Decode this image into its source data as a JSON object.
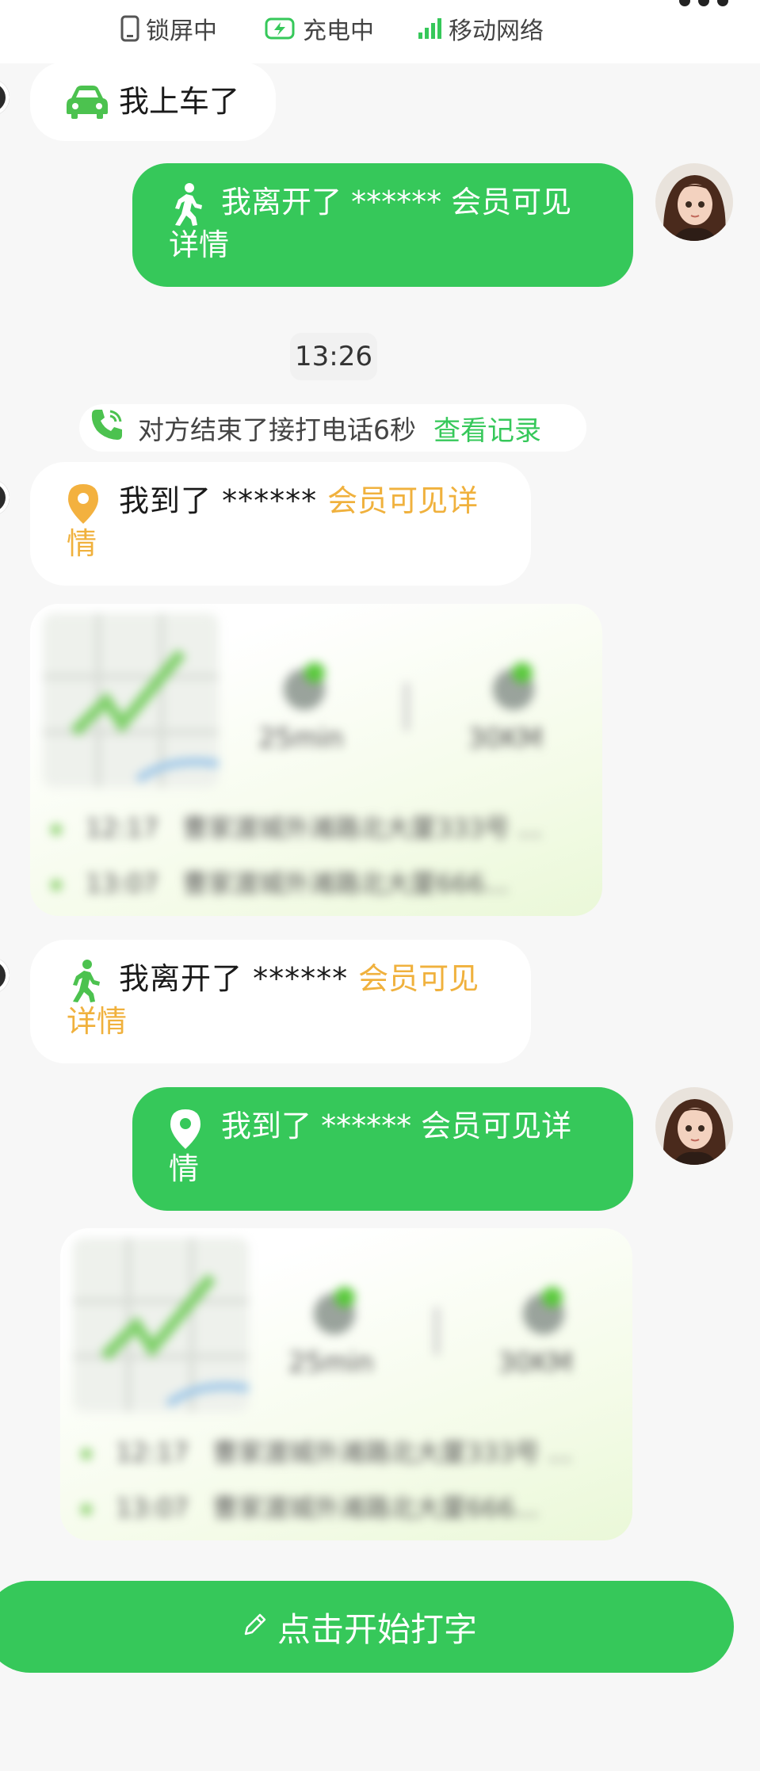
{
  "status_bar": {
    "lock": "锁屏中",
    "charging": "充电中",
    "network": "移动网络"
  },
  "messages": {
    "m1": {
      "text": "我上车了"
    },
    "m2": {
      "line1": "我离开了 ****** 会员可见",
      "line2": "详情"
    },
    "time": "13:26",
    "call": {
      "text": "对方结束了接打电话6秒",
      "link": "查看记录"
    },
    "m3": {
      "prefix": "我到了 ****** ",
      "highlight": "会员可见详",
      "line2": "情"
    },
    "m4": {
      "prefix": "我离开了 ****** ",
      "highlight": "会员可见",
      "line2": "详情"
    },
    "m5": {
      "line1": "我到了 ****** 会员可见详",
      "line2": "情"
    }
  },
  "route_card_1": {
    "duration": "25min",
    "distance": "30KM",
    "rows": [
      {
        "time": "12:17",
        "address": "曹家渡城外滩路北大厦333号 ..."
      },
      {
        "time": "13:07",
        "address": "曹家渡城外滩路北大厦666..."
      }
    ]
  },
  "route_card_2": {
    "duration": "25min",
    "distance": "30KM",
    "rows": [
      {
        "time": "12:17",
        "address": "曹家渡城外滩路北大厦333号 ..."
      },
      {
        "time": "13:07",
        "address": "曹家渡城外滩路北大厦666..."
      }
    ]
  },
  "input": {
    "label": "点击开始打字"
  },
  "colors": {
    "accent": "#36c85a",
    "highlight": "#f0b13d",
    "background": "#f7f7f7"
  },
  "icons": [
    "phone-lock-icon",
    "battery-charging-icon",
    "signal-icon",
    "more-icon",
    "car-icon",
    "walking-icon",
    "location-pin-icon",
    "phone-call-icon",
    "edit-pencil-icon"
  ]
}
